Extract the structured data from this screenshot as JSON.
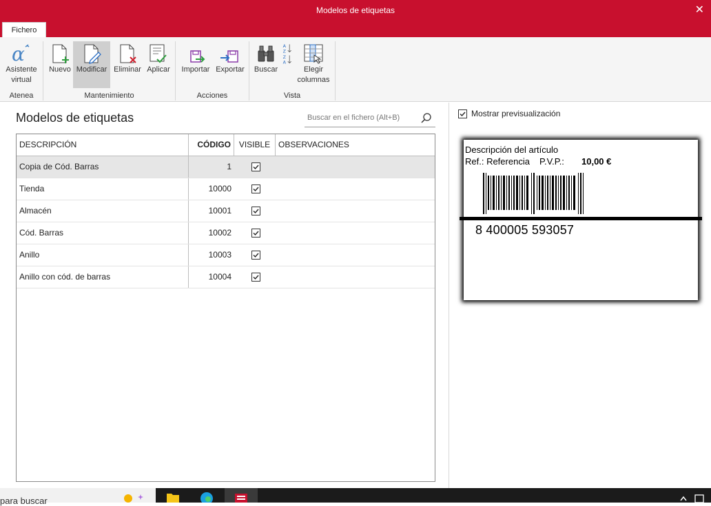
{
  "window": {
    "title": "Modelos de etiquetas",
    "close_symbol": "✕"
  },
  "ribbon": {
    "tab": "Fichero",
    "groups": [
      {
        "label": "Atenea"
      },
      {
        "label": "Mantenimiento"
      },
      {
        "label": "Acciones"
      },
      {
        "label": "Vista"
      }
    ],
    "buttons": {
      "asistente": {
        "line1": "Asistente",
        "line2": "virtual",
        "icon": "alpha-icon"
      },
      "nuevo": {
        "label": "Nuevo",
        "icon": "new-document-icon"
      },
      "modificar": {
        "label": "Modificar",
        "icon": "edit-document-icon"
      },
      "eliminar": {
        "label": "Eliminar",
        "icon": "delete-document-icon"
      },
      "aplicar": {
        "label": "Aplicar",
        "icon": "apply-checklist-icon"
      },
      "importar": {
        "label": "Importar",
        "icon": "import-icon"
      },
      "exportar": {
        "label": "Exportar",
        "icon": "export-icon"
      },
      "buscar": {
        "label": "Buscar",
        "icon": "binoculars-icon"
      },
      "sort": {
        "icon": "sort-az-icon"
      },
      "elegir": {
        "line1": "Elegir",
        "line2": "columnas",
        "icon": "choose-columns-icon"
      }
    }
  },
  "main": {
    "title": "Modelos de etiquetas",
    "search_placeholder": "Buscar en el fichero (Alt+B)",
    "columns": {
      "descripcion": "DESCRIPCIÓN",
      "codigo": "CÓDIGO",
      "visible": "VISIBLE",
      "observaciones": "OBSERVACIONES"
    },
    "rows": [
      {
        "descripcion": "Copia de Cód. Barras",
        "codigo": "1",
        "visible": true,
        "observaciones": ""
      },
      {
        "descripcion": "Tienda",
        "codigo": "10000",
        "visible": true,
        "observaciones": ""
      },
      {
        "descripcion": "Almacén",
        "codigo": "10001",
        "visible": true,
        "observaciones": ""
      },
      {
        "descripcion": "Cód. Barras",
        "codigo": "10002",
        "visible": true,
        "observaciones": ""
      },
      {
        "descripcion": "Anillo",
        "codigo": "10003",
        "visible": true,
        "observaciones": ""
      },
      {
        "descripcion": "Anillo con cód. de barras",
        "codigo": "10004",
        "visible": true,
        "observaciones": ""
      }
    ]
  },
  "preview": {
    "toggle_label": "Mostrar previsualización",
    "toggle_checked": true,
    "label": {
      "descripcion": "Descripción del artículo",
      "ref": "Ref.: Referencia",
      "pvp_label": "P.V.P.:",
      "price": "10,00 €",
      "barcode_number": "8 400005  593057"
    }
  },
  "taskbar": {
    "search_text": "para buscar"
  },
  "colors": {
    "accent": "#c8102e",
    "ribbon_bg": "#f5f5f5",
    "selected_row": "#e6e6e6"
  }
}
